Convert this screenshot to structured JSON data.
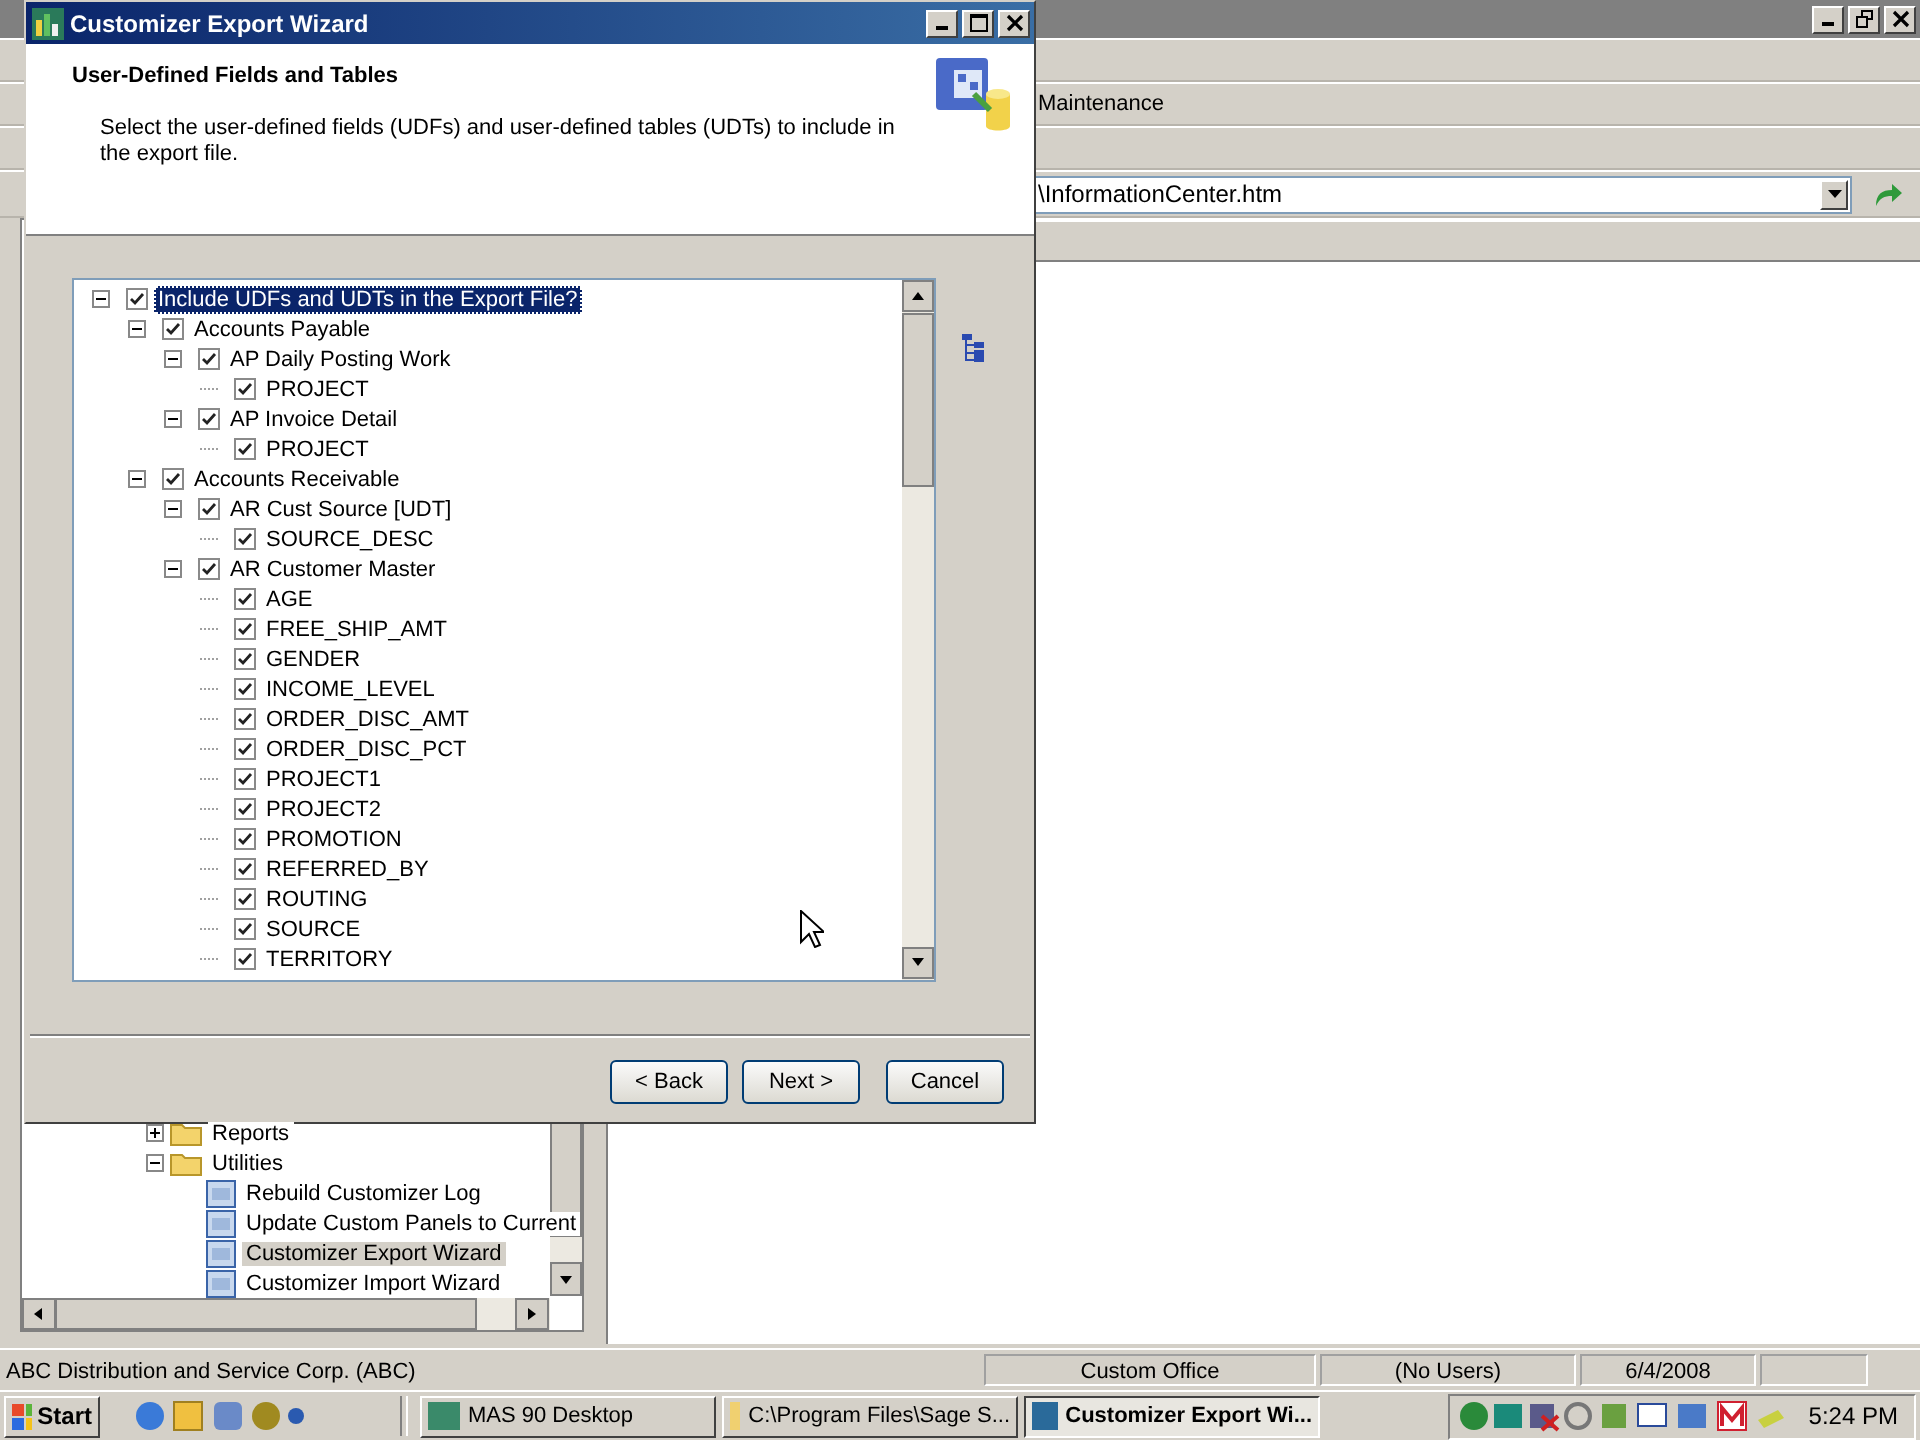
{
  "app": {
    "menu_label": "Maintenance",
    "address": {
      "value": "\\InformationCenter.htm"
    }
  },
  "nav_tree": [
    {
      "label": "Reports",
      "kind": "folder",
      "expanded": false,
      "selected": false
    },
    {
      "label": "Utilities",
      "kind": "folder",
      "expanded": true,
      "selected": false,
      "children": [
        {
          "label": "Rebuild Customizer Log",
          "kind": "task",
          "selected": false
        },
        {
          "label": "Update Custom Panels to Current",
          "kind": "task",
          "selected": false
        },
        {
          "label": "Customizer Export Wizard",
          "kind": "task",
          "selected": true
        },
        {
          "label": "Customizer Import Wizard",
          "kind": "task",
          "selected": false
        }
      ]
    }
  ],
  "status_bar": [
    "ABC Distribution and Service Corp. (ABC)",
    "Custom Office",
    "(No Users)",
    "6/4/2008"
  ],
  "taskbar": {
    "start": "Start",
    "tasks": [
      {
        "label": "MAS 90 Desktop",
        "selected": false
      },
      {
        "label": "C:\\Program Files\\Sage S...",
        "selected": false
      },
      {
        "label": "Customizer Export Wi...",
        "selected": true
      }
    ],
    "clock": "5:24 PM"
  },
  "dialog": {
    "title": "Customizer Export Wizard",
    "heading": "User-Defined Fields and Tables",
    "description": "Select the user-defined fields (UDFs) and user-defined tables (UDTs) to include in the export file.",
    "tree": [
      {
        "label": "Include UDFs and UDTs in the Export File?",
        "checked": true,
        "expanded": true,
        "selected": true,
        "children": [
          {
            "label": "Accounts Payable",
            "checked": true,
            "expanded": true,
            "selected": false,
            "children": [
              {
                "label": "AP Daily Posting Work",
                "checked": true,
                "expanded": true,
                "selected": false,
                "children": [
                  {
                    "label": "PROJECT",
                    "checked": true,
                    "selected": false
                  }
                ]
              },
              {
                "label": "AP Invoice Detail",
                "checked": true,
                "expanded": true,
                "selected": false,
                "children": [
                  {
                    "label": "PROJECT",
                    "checked": true,
                    "selected": false
                  }
                ]
              }
            ]
          },
          {
            "label": "Accounts Receivable",
            "checked": true,
            "expanded": true,
            "selected": false,
            "children": [
              {
                "label": "AR Cust Source  [UDT]",
                "checked": true,
                "expanded": true,
                "selected": false,
                "children": [
                  {
                    "label": "SOURCE_DESC",
                    "checked": true,
                    "selected": false
                  }
                ]
              },
              {
                "label": "AR Customer Master",
                "checked": true,
                "expanded": true,
                "selected": false,
                "children": [
                  {
                    "label": "AGE",
                    "checked": true,
                    "selected": false
                  },
                  {
                    "label": "FREE_SHIP_AMT",
                    "checked": true,
                    "selected": false
                  },
                  {
                    "label": "GENDER",
                    "checked": true,
                    "selected": false
                  },
                  {
                    "label": "INCOME_LEVEL",
                    "checked": true,
                    "selected": false
                  },
                  {
                    "label": "ORDER_DISC_AMT",
                    "checked": true,
                    "selected": false
                  },
                  {
                    "label": "ORDER_DISC_PCT",
                    "checked": true,
                    "selected": false
                  },
                  {
                    "label": "PROJECT1",
                    "checked": true,
                    "selected": false
                  },
                  {
                    "label": "PROJECT2",
                    "checked": true,
                    "selected": false
                  },
                  {
                    "label": "PROMOTION",
                    "checked": true,
                    "selected": false
                  },
                  {
                    "label": "REFERRED_BY",
                    "checked": true,
                    "selected": false
                  },
                  {
                    "label": "ROUTING",
                    "checked": true,
                    "selected": false
                  },
                  {
                    "label": "SOURCE",
                    "checked": true,
                    "selected": false
                  },
                  {
                    "label": "TERRITORY",
                    "checked": true,
                    "selected": false
                  }
                ]
              }
            ]
          }
        ]
      }
    ],
    "buttons": [
      "< Back",
      "Next >",
      "Cancel"
    ]
  }
}
